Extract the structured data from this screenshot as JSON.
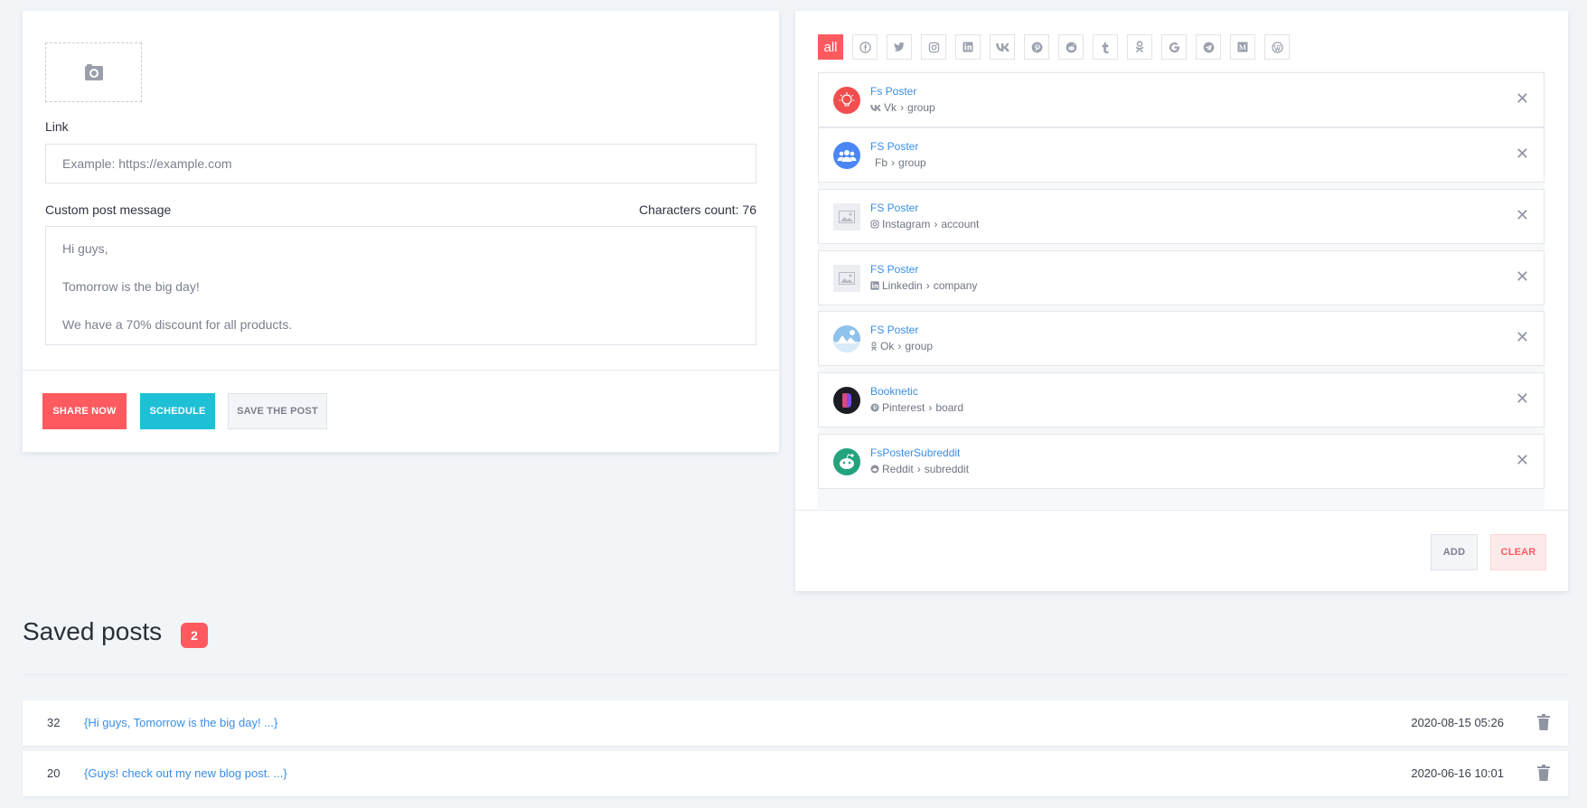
{
  "composer": {
    "link_label": "Link",
    "link_placeholder": "Example: https://example.com",
    "message_label": "Custom post message",
    "char_count": "Characters count: 76",
    "message": "Hi guys,\n\nTomorrow is the big day!\n\nWe have a 70% discount for all products.",
    "share_now": "SHARE NOW",
    "schedule": "SCHEDULE",
    "save_post": "SAVE THE POST"
  },
  "accounts": {
    "filters": {
      "all": "all",
      "icons": [
        "facebook-icon",
        "twitter-icon",
        "instagram-icon",
        "linkedin-icon",
        "vk-icon",
        "pinterest-icon",
        "reddit-icon",
        "tumblr-icon",
        "odnoklassniki-icon",
        "google-icon",
        "telegram-icon",
        "medium-icon",
        "wordpress-icon"
      ]
    },
    "items": [
      {
        "name": "Fs Poster",
        "network": "Vk",
        "type": "group",
        "icon": "vk-icon",
        "avatar_color": "#f04e4e"
      },
      {
        "name": "FS Poster",
        "network": "Fb",
        "type": "group",
        "icon": "facebook-icon",
        "avatar_color": "#4a86f5"
      },
      {
        "name": "FS Poster",
        "network": "Instagram",
        "type": "account",
        "icon": "instagram-icon",
        "avatar_color": "#eceef2"
      },
      {
        "name": "FS Poster",
        "network": "Linkedin",
        "type": "company",
        "icon": "linkedin-icon",
        "avatar_color": "#eceef2"
      },
      {
        "name": "FS Poster",
        "network": "Ok",
        "type": "group",
        "icon": "odnoklassniki-icon",
        "avatar_color": "#8fc3ec"
      },
      {
        "name": "Booknetic",
        "network": "Pinterest",
        "type": "board",
        "icon": "pinterest-icon",
        "avatar_color": "#1c1d22"
      },
      {
        "name": "FsPosterSubreddit",
        "network": "Reddit",
        "type": "subreddit",
        "icon": "reddit-icon",
        "avatar_color": "#23a37e"
      }
    ],
    "add": "ADD",
    "clear": "CLEAR"
  },
  "saved": {
    "title": "Saved posts",
    "count": "2",
    "posts": [
      {
        "id": "32",
        "text": "{Hi guys, Tomorrow is the big day! ...}",
        "date": "2020-08-15 05:26"
      },
      {
        "id": "20",
        "text": "{Guys! check out my new blog post. ...}",
        "date": "2020-06-16 10:01"
      }
    ]
  },
  "colors": {
    "accent": "#ff5a5f",
    "schedule": "#1ec0d6",
    "link": "#3a8ee6"
  }
}
